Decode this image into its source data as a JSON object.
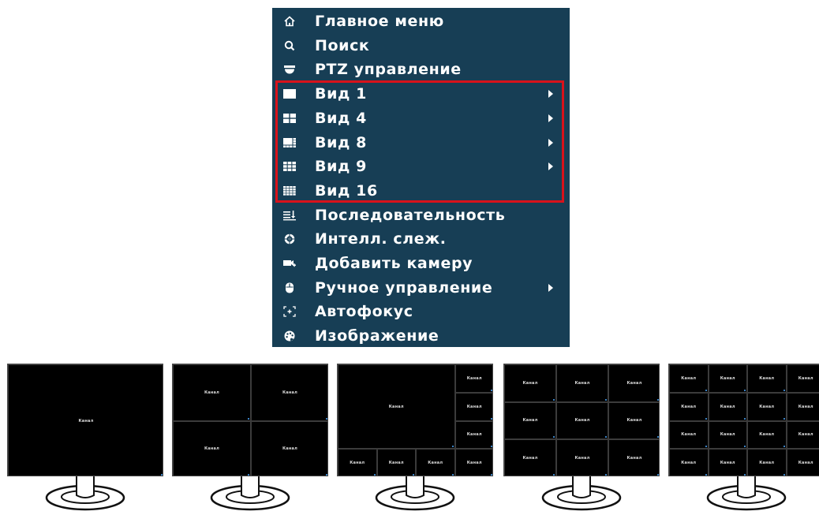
{
  "menu": {
    "items": [
      {
        "icon": "home-icon",
        "label": "Главное меню",
        "has_submenu": false
      },
      {
        "icon": "search-icon",
        "label": "Поиск",
        "has_submenu": false
      },
      {
        "icon": "ptz-camera-icon",
        "label": "PTZ управление",
        "has_submenu": false
      },
      {
        "icon": "view-1-icon",
        "label": "Вид 1",
        "has_submenu": true
      },
      {
        "icon": "view-4-icon",
        "label": "Вид 4",
        "has_submenu": true
      },
      {
        "icon": "view-8-icon",
        "label": "Вид 8",
        "has_submenu": true
      },
      {
        "icon": "view-9-icon",
        "label": "Вид 9",
        "has_submenu": true
      },
      {
        "icon": "view-16-icon",
        "label": "Вид 16",
        "has_submenu": false
      },
      {
        "icon": "sequence-icon",
        "label": "Последовательность",
        "has_submenu": false
      },
      {
        "icon": "smart-track-icon",
        "label": "Интелл. слеж.",
        "has_submenu": false
      },
      {
        "icon": "add-camera-icon",
        "label": "Добавить камеру",
        "has_submenu": false
      },
      {
        "icon": "mouse-icon",
        "label": "Ручное управление",
        "has_submenu": true
      },
      {
        "icon": "autofocus-icon",
        "label": "Автофокус",
        "has_submenu": false
      },
      {
        "icon": "image-settings-icon",
        "label": "Изображение",
        "has_submenu": false
      }
    ]
  },
  "colors": {
    "menu_background": "#173e55",
    "menu_text": "#ffffff",
    "highlight_border": "#d8121b",
    "screen_background": "#000000"
  },
  "monitors": [
    {
      "layout": "1",
      "cell_label": "Канал"
    },
    {
      "layout": "4",
      "cell_label": "Канал"
    },
    {
      "layout": "8",
      "cell_label": "Канал"
    },
    {
      "layout": "9",
      "cell_label": "Канал"
    },
    {
      "layout": "16",
      "cell_label": "Канал"
    }
  ]
}
